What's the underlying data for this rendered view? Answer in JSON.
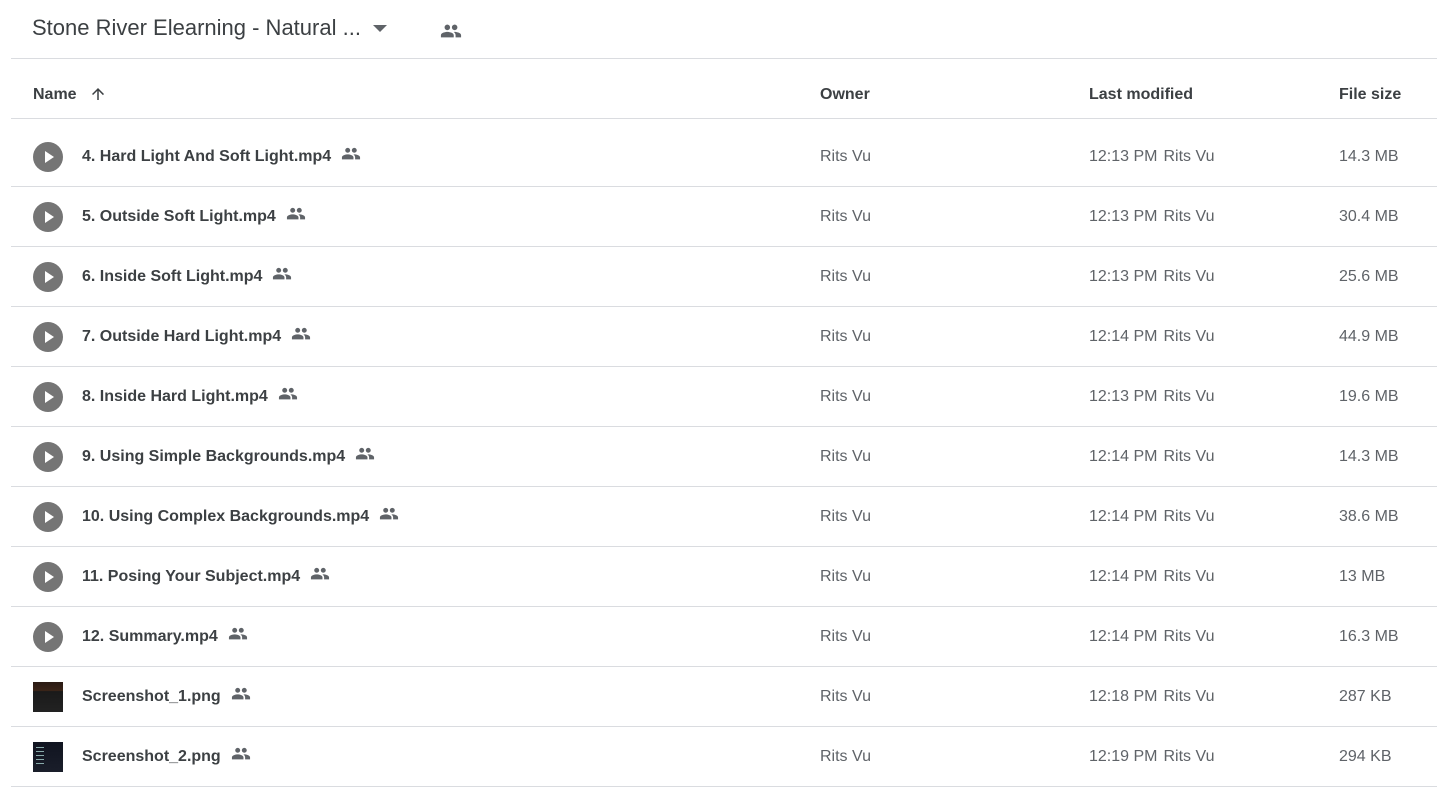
{
  "folder": {
    "title": "Stone River Elearning - Natural ...",
    "caret_icon": "arrow-drop-down-icon",
    "shared_icon": "people-icon"
  },
  "columns": {
    "name": "Name",
    "owner": "Owner",
    "last_modified": "Last modified",
    "file_size": "File size",
    "sort_icon": "arrow-upward-icon"
  },
  "colors": {
    "text": "#3c4043",
    "secondary_text": "#5f6368",
    "divider": "#dadce0",
    "video_icon": "#757575"
  },
  "files": [
    {
      "name": "4. Hard Light And Soft Light.mp4",
      "type": "video",
      "owner": "Rits Vu",
      "time": "12:13 PM",
      "modified_by": "Rits Vu",
      "size": "14.3 MB"
    },
    {
      "name": "5. Outside Soft Light.mp4",
      "type": "video",
      "owner": "Rits Vu",
      "time": "12:13 PM",
      "modified_by": "Rits Vu",
      "size": "30.4 MB"
    },
    {
      "name": "6. Inside Soft Light.mp4",
      "type": "video",
      "owner": "Rits Vu",
      "time": "12:13 PM",
      "modified_by": "Rits Vu",
      "size": "25.6 MB"
    },
    {
      "name": "7. Outside Hard Light.mp4",
      "type": "video",
      "owner": "Rits Vu",
      "time": "12:14 PM",
      "modified_by": "Rits Vu",
      "size": "44.9 MB"
    },
    {
      "name": "8. Inside Hard Light.mp4",
      "type": "video",
      "owner": "Rits Vu",
      "time": "12:13 PM",
      "modified_by": "Rits Vu",
      "size": "19.6 MB"
    },
    {
      "name": "9. Using Simple Backgrounds.mp4",
      "type": "video",
      "owner": "Rits Vu",
      "time": "12:14 PM",
      "modified_by": "Rits Vu",
      "size": "14.3 MB"
    },
    {
      "name": "10. Using Complex Backgrounds.mp4",
      "type": "video",
      "owner": "Rits Vu",
      "time": "12:14 PM",
      "modified_by": "Rits Vu",
      "size": "38.6 MB"
    },
    {
      "name": "11. Posing Your Subject.mp4",
      "type": "video",
      "owner": "Rits Vu",
      "time": "12:14 PM",
      "modified_by": "Rits Vu",
      "size": "13 MB"
    },
    {
      "name": "12. Summary.mp4",
      "type": "video",
      "owner": "Rits Vu",
      "time": "12:14 PM",
      "modified_by": "Rits Vu",
      "size": "16.3 MB"
    },
    {
      "name": "Screenshot_1.png",
      "type": "image",
      "variant": "v1",
      "owner": "Rits Vu",
      "time": "12:18 PM",
      "modified_by": "Rits Vu",
      "size": "287 KB"
    },
    {
      "name": "Screenshot_2.png",
      "type": "image",
      "variant": "v2",
      "owner": "Rits Vu",
      "time": "12:19 PM",
      "modified_by": "Rits Vu",
      "size": "294 KB"
    }
  ]
}
